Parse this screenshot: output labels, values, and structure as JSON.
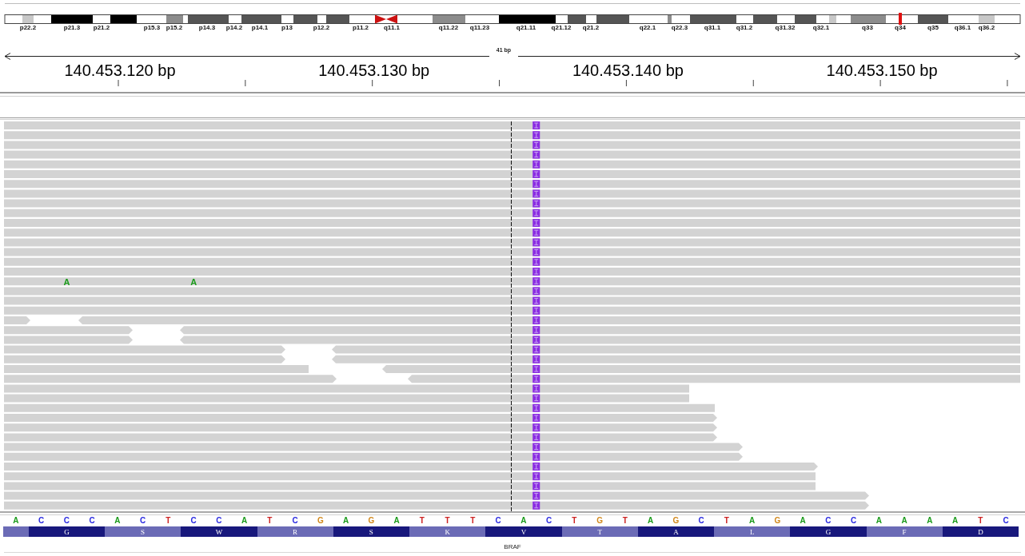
{
  "ideogram": {
    "bands": [
      {
        "label": "p22.2",
        "selected": false
      },
      {
        "label": "p21.3",
        "selected": false
      },
      {
        "label": "p21.2",
        "selected": false
      },
      {
        "label": "p15.3",
        "selected": false
      },
      {
        "label": "p15.2",
        "selected": false
      },
      {
        "label": "p14.3",
        "selected": false
      },
      {
        "label": "p14.2",
        "selected": false
      },
      {
        "label": "p14.1",
        "selected": false
      },
      {
        "label": "p13",
        "selected": false
      },
      {
        "label": "p12.2",
        "selected": false
      },
      {
        "label": "p11.2",
        "selected": false
      },
      {
        "label": "q11.1",
        "selected": false
      },
      {
        "label": "q11.22",
        "selected": false
      },
      {
        "label": "q11.23",
        "selected": false
      },
      {
        "label": "q21.11",
        "selected": false
      },
      {
        "label": "q21.12",
        "selected": false
      },
      {
        "label": "q21.2",
        "selected": false
      },
      {
        "label": "q22.1",
        "selected": false
      },
      {
        "label": "q22.3",
        "selected": false
      },
      {
        "label": "q31.1",
        "selected": false
      },
      {
        "label": "q31.2",
        "selected": false
      },
      {
        "label": "q31.32",
        "selected": false
      },
      {
        "label": "q32.1",
        "selected": false
      },
      {
        "label": "q33",
        "selected": false
      },
      {
        "label": "q34",
        "selected": true
      },
      {
        "label": "q35",
        "selected": false
      },
      {
        "label": "q36.1",
        "selected": false
      },
      {
        "label": "q36.2",
        "selected": false
      }
    ]
  },
  "ruler": {
    "span": "41 bp",
    "ticks": [
      "140.453.120 bp",
      "140.453.130 bp",
      "140.453.140 bp",
      "140.453.150 bp"
    ]
  },
  "alignments": {
    "rows": [
      {
        "insertion": true
      },
      {
        "insertion": true
      },
      {
        "insertion": true
      },
      {
        "insertion": true
      },
      {
        "insertion": true
      },
      {
        "insertion": true
      },
      {
        "insertion": true
      },
      {
        "insertion": true
      },
      {
        "insertion": true
      },
      {
        "insertion": true
      },
      {
        "insertion": true
      },
      {
        "insertion": true
      },
      {
        "insertion": true
      },
      {
        "insertion": true
      },
      {
        "insertion": true
      },
      {
        "insertion": true
      },
      {
        "insertion": true,
        "mismatches": [
          {
            "base": "A",
            "color": "#1a9a1a"
          },
          {
            "base": "A",
            "color": "#1a9a1a"
          }
        ]
      },
      {
        "insertion": true
      },
      {
        "insertion": true
      },
      {
        "insertion": true
      },
      {
        "insertion": true
      },
      {
        "insertion": true
      },
      {
        "insertion": true
      },
      {
        "insertion": true
      },
      {
        "insertion": true
      },
      {
        "insertion": true
      },
      {
        "insertion": true
      },
      {
        "insertion": true
      },
      {
        "insertion": true
      },
      {
        "insertion": true
      },
      {
        "insertion": true
      },
      {
        "insertion": true
      },
      {
        "insertion": true
      },
      {
        "insertion": true
      },
      {
        "insertion": true
      },
      {
        "insertion": true
      },
      {
        "insertion": true
      },
      {
        "insertion": true
      },
      {
        "insertion": true
      },
      {
        "insertion": true
      }
    ]
  },
  "sequence": {
    "bases": [
      {
        "base": "A",
        "color": "#1a9a1a"
      },
      {
        "base": "C",
        "color": "#2a2ae0"
      },
      {
        "base": "C",
        "color": "#2a2ae0"
      },
      {
        "base": "C",
        "color": "#2a2ae0"
      },
      {
        "base": "A",
        "color": "#1a9a1a"
      },
      {
        "base": "C",
        "color": "#2a2ae0"
      },
      {
        "base": "T",
        "color": "#cc2222"
      },
      {
        "base": "C",
        "color": "#2a2ae0"
      },
      {
        "base": "C",
        "color": "#2a2ae0"
      },
      {
        "base": "A",
        "color": "#1a9a1a"
      },
      {
        "base": "T",
        "color": "#cc2222"
      },
      {
        "base": "C",
        "color": "#2a2ae0"
      },
      {
        "base": "G",
        "color": "#d1871a"
      },
      {
        "base": "A",
        "color": "#1a9a1a"
      },
      {
        "base": "G",
        "color": "#d1871a"
      },
      {
        "base": "A",
        "color": "#1a9a1a"
      },
      {
        "base": "T",
        "color": "#cc2222"
      },
      {
        "base": "T",
        "color": "#cc2222"
      },
      {
        "base": "T",
        "color": "#cc2222"
      },
      {
        "base": "C",
        "color": "#2a2ae0"
      },
      {
        "base": "A",
        "color": "#1a9a1a"
      },
      {
        "base": "C",
        "color": "#2a2ae0"
      },
      {
        "base": "T",
        "color": "#cc2222"
      },
      {
        "base": "G",
        "color": "#d1871a"
      },
      {
        "base": "T",
        "color": "#cc2222"
      },
      {
        "base": "A",
        "color": "#1a9a1a"
      },
      {
        "base": "G",
        "color": "#d1871a"
      },
      {
        "base": "C",
        "color": "#2a2ae0"
      },
      {
        "base": "T",
        "color": "#cc2222"
      },
      {
        "base": "A",
        "color": "#1a9a1a"
      },
      {
        "base": "G",
        "color": "#d1871a"
      },
      {
        "base": "A",
        "color": "#1a9a1a"
      },
      {
        "base": "C",
        "color": "#2a2ae0"
      },
      {
        "base": "C",
        "color": "#2a2ae0"
      },
      {
        "base": "A",
        "color": "#1a9a1a"
      },
      {
        "base": "A",
        "color": "#1a9a1a"
      },
      {
        "base": "A",
        "color": "#1a9a1a"
      },
      {
        "base": "A",
        "color": "#1a9a1a"
      },
      {
        "base": "T",
        "color": "#cc2222"
      },
      {
        "base": "C",
        "color": "#2a2ae0"
      }
    ]
  },
  "translation": {
    "amino_acids": [
      {
        "color": "#6b6bb6"
      },
      {
        "letter": "G",
        "color": "#18187c"
      },
      {
        "letter": "S",
        "color": "#6b6bb6"
      },
      {
        "letter": "W",
        "color": "#18187c"
      },
      {
        "letter": "R",
        "color": "#6b6bb6"
      },
      {
        "letter": "S",
        "color": "#18187c"
      },
      {
        "letter": "K",
        "color": "#6b6bb6"
      },
      {
        "letter": "V",
        "color": "#18187c"
      },
      {
        "letter": "T",
        "color": "#6b6bb6"
      },
      {
        "letter": "A",
        "color": "#18187c"
      },
      {
        "letter": "L",
        "color": "#6b6bb6"
      },
      {
        "letter": "G",
        "color": "#18187c"
      },
      {
        "letter": "F",
        "color": "#6b6bb6"
      },
      {
        "letter": "D",
        "color": "#18187c"
      }
    ]
  },
  "gene": {
    "name": "BRAF"
  }
}
